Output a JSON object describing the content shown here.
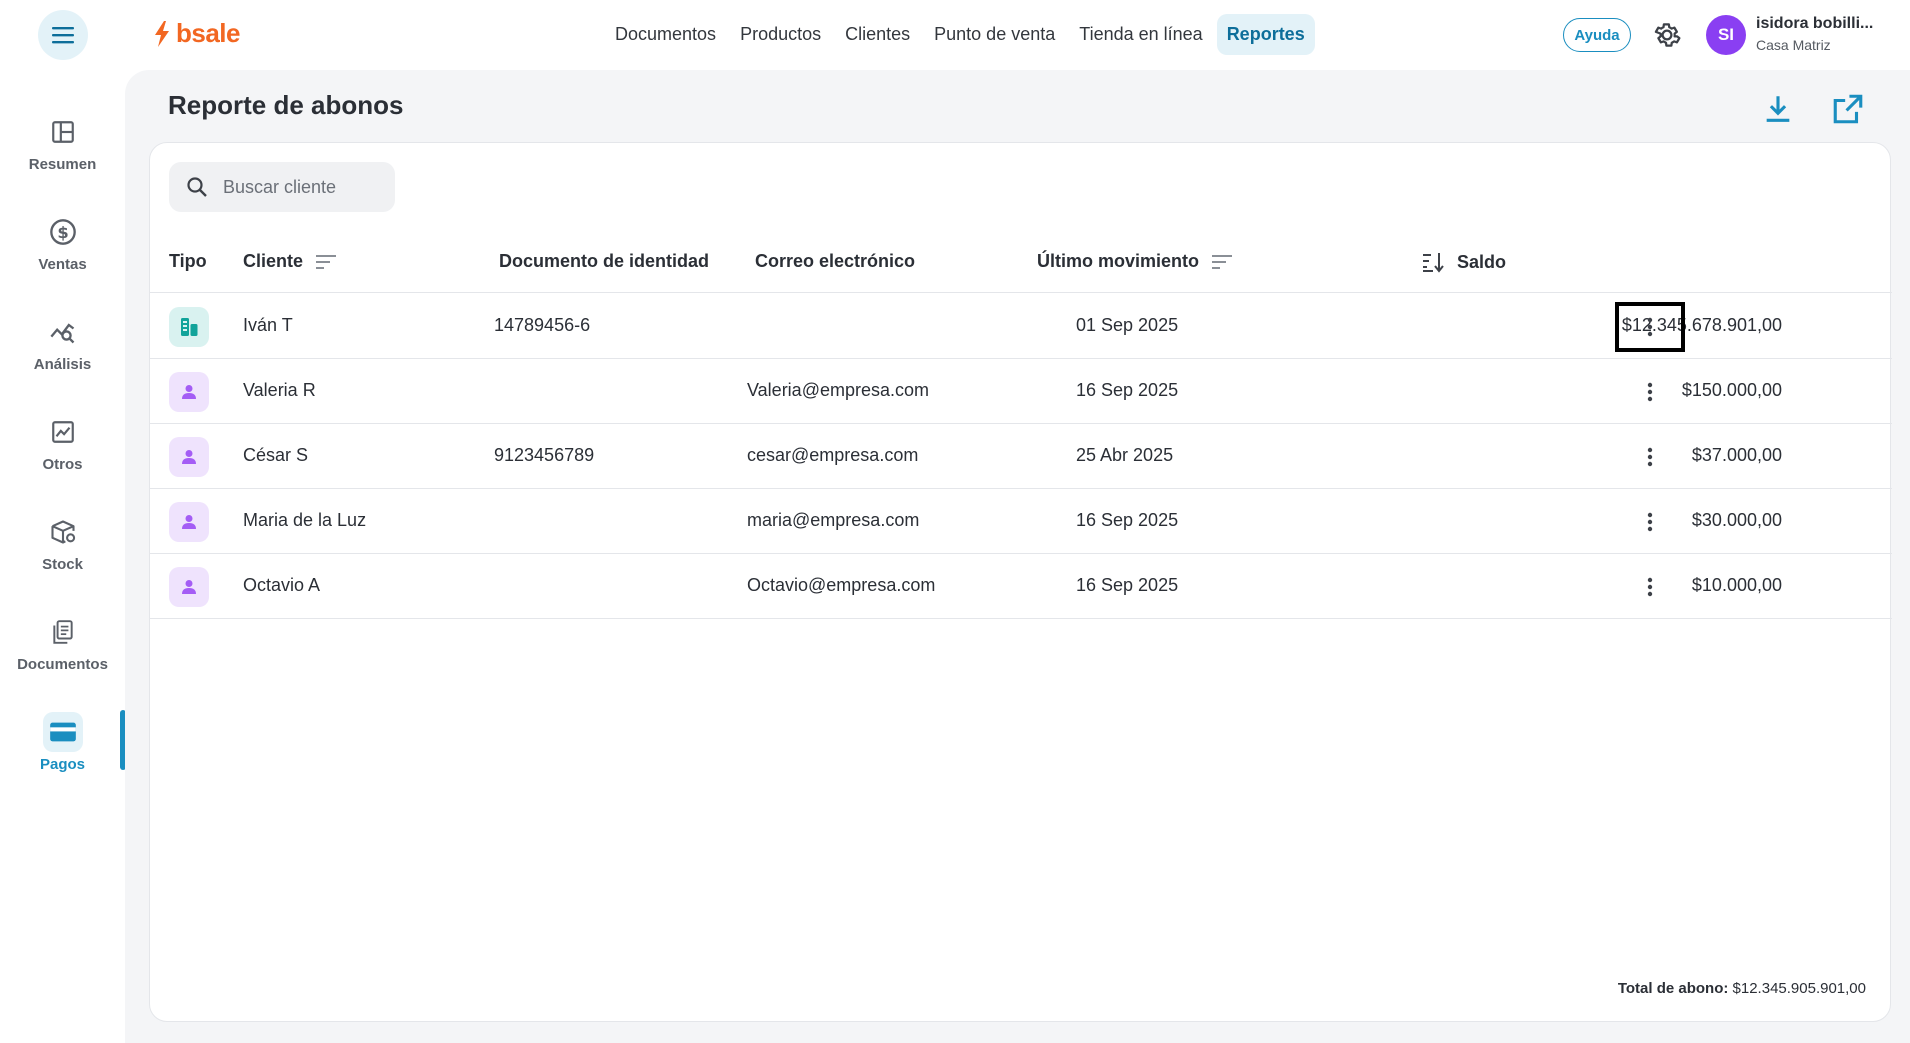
{
  "brand": {
    "name": "bsale",
    "color": "#f26722"
  },
  "topnav": {
    "items": [
      "Documentos",
      "Productos",
      "Clientes",
      "Punto de venta",
      "Tienda en línea",
      "Reportes"
    ],
    "active": "Reportes"
  },
  "header": {
    "help_label": "Ayuda",
    "user_initials": "SI",
    "user_name": "isidora bobilli...",
    "user_branch": "Casa Matriz"
  },
  "sidebar": {
    "items": [
      {
        "label": "Resumen",
        "icon": "layout-icon"
      },
      {
        "label": "Ventas",
        "icon": "dollar-icon"
      },
      {
        "label": "Análisis",
        "icon": "analytics-icon"
      },
      {
        "label": "Otros",
        "icon": "trend-chart-icon"
      },
      {
        "label": "Stock",
        "icon": "stock-box-icon"
      },
      {
        "label": "Documentos",
        "icon": "documents-icon"
      },
      {
        "label": "Pagos",
        "icon": "card-icon"
      }
    ],
    "active": "Pagos"
  },
  "page": {
    "title": "Reporte de abonos",
    "search_placeholder": "Buscar cliente"
  },
  "table": {
    "columns": {
      "tipo": "Tipo",
      "cliente": "Cliente",
      "documento": "Documento de identidad",
      "correo": "Correo electrónico",
      "ultimo": "Último movimiento",
      "saldo": "Saldo"
    },
    "rows": [
      {
        "tipo": "empresa",
        "cliente": "Iván T",
        "documento": "14789456-6",
        "correo": "",
        "ultimo": "01 Sep 2025",
        "saldo": "$12.345.678.901,00"
      },
      {
        "tipo": "persona",
        "cliente": "Valeria R",
        "documento": "",
        "correo": "Valeria@empresa.com",
        "ultimo": "16 Sep 2025",
        "saldo": "$150.000,00"
      },
      {
        "tipo": "persona",
        "cliente": "César S",
        "documento": "9123456789",
        "correo": "cesar@empresa.com",
        "ultimo": "25 Abr 2025",
        "saldo": "$37.000,00"
      },
      {
        "tipo": "persona",
        "cliente": "Maria de la Luz",
        "documento": "",
        "correo": "maria@empresa.com",
        "ultimo": "16 Sep 2025",
        "saldo": "$30.000,00"
      },
      {
        "tipo": "persona",
        "cliente": "Octavio A",
        "documento": "",
        "correo": "Octavio@empresa.com",
        "ultimo": "16 Sep 2025",
        "saldo": "$10.000,00"
      }
    ]
  },
  "footer": {
    "total_label": "Total de abono:",
    "total_value": "$12.345.905.901,00"
  },
  "colors": {
    "accent": "#1a8ec0",
    "avatar": "#8a3ff2",
    "company_icon": "#11a39a",
    "person_icon": "#a45df5"
  }
}
